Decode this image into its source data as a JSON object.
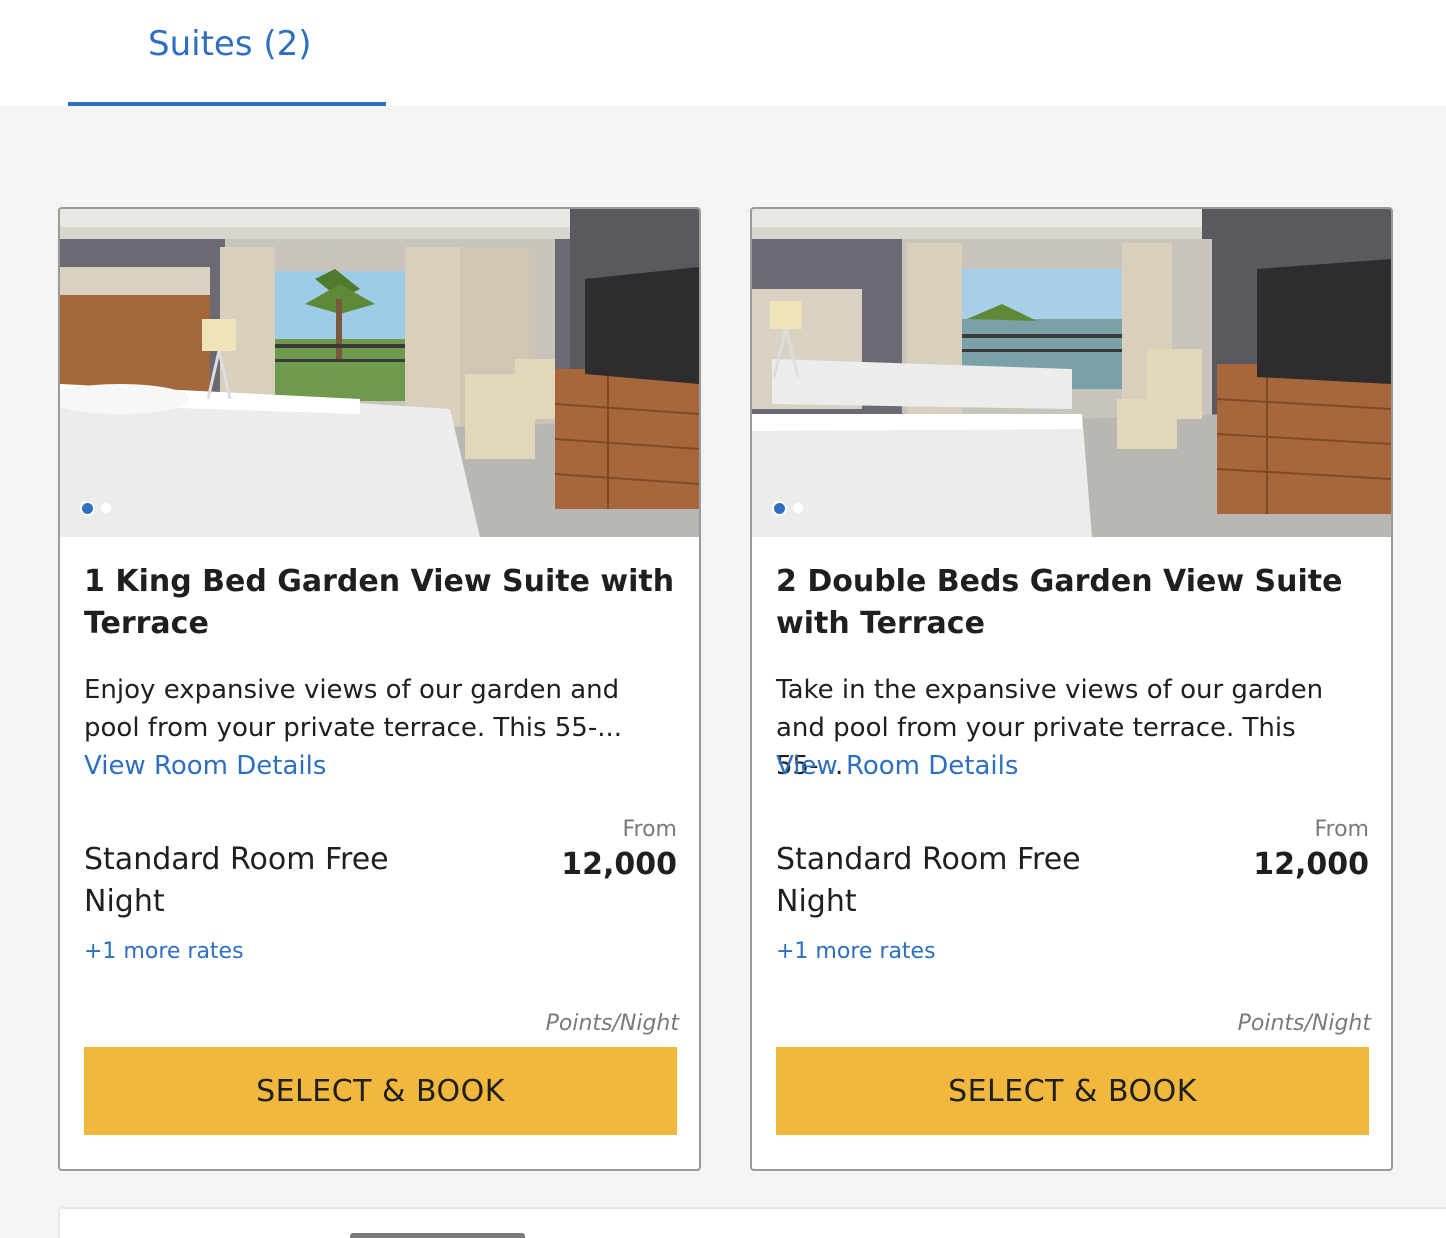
{
  "tabs": [
    {
      "label": "Suites (2)",
      "active": true
    }
  ],
  "rooms": [
    {
      "title": "1 King Bed Garden View Suite with Terrace",
      "description": "Enjoy expansive views of our garden and pool from your private terrace. This 55-...",
      "details_link": "View Room Details",
      "rate_name": "Standard Room Free Night",
      "from_label": "From",
      "price": "12,000",
      "more_rates": "+1 more rates",
      "unit": "Points/Night",
      "book_label": "SELECT & BOOK",
      "image": "photo-king-suite",
      "carousel": {
        "count": 2,
        "active": 1
      }
    },
    {
      "title": "2 Double Beds Garden View Suite with Terrace",
      "description": "Take in the expansive views of our garden and pool from your private terrace. This 55-...",
      "details_link": "View Room Details",
      "rate_name": "Standard Room Free Night",
      "from_label": "From",
      "price": "12,000",
      "more_rates": "+1 more rates",
      "unit": "Points/Night",
      "book_label": "SELECT & BOOK",
      "image": "photo-double-suite",
      "carousel": {
        "count": 2,
        "active": 1
      }
    }
  ],
  "colors": {
    "accent": "#2f6fc0",
    "button": "#f2b83e",
    "page_bg": "#f4f4f4"
  }
}
